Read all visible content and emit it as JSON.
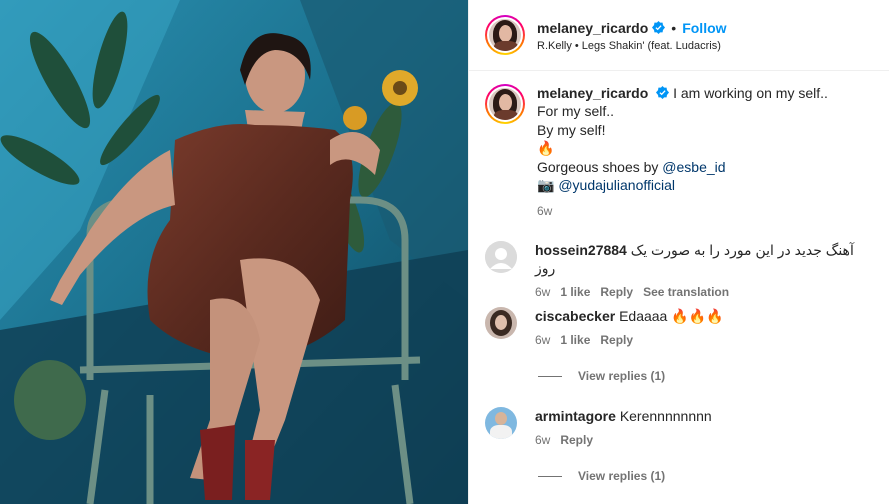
{
  "header": {
    "username": "melaney_ricardo",
    "follow_label": "Follow",
    "separator": "•",
    "song": "R.Kelly • Legs Shakin' (feat. Ludacris)"
  },
  "caption": {
    "username": "melaney_ricardo",
    "line1": "I am working on my self..",
    "line2": "For my self..",
    "line3": "By my self!",
    "line4_emoji": "🔥",
    "line5_prefix": "Gorgeous shoes by ",
    "line5_mention": "@esbe_id",
    "line6_emoji": "📷",
    "line6_mention": "@yudajulianofficial",
    "time": "6w"
  },
  "comments": [
    {
      "username": "hossein27884",
      "text": "آهنگ جدید در این مورد را به صورت یک روز",
      "time": "6w",
      "likes": "1 like",
      "reply": "Reply",
      "extra": "See translation"
    },
    {
      "username": "ciscabecker",
      "text": "Edaaaa 🔥🔥🔥",
      "time": "6w",
      "likes": "1 like",
      "reply": "Reply",
      "view_replies": "View replies (1)"
    },
    {
      "username": "armintagore",
      "text": "Kerennnnnnnn",
      "time": "6w",
      "reply": "Reply",
      "view_replies": "View replies (1)"
    }
  ],
  "colors": {
    "accent": "#0095f6",
    "verified": "#0095f6",
    "muted": "#737373"
  },
  "icons": {
    "verified": "verified-badge-icon"
  }
}
